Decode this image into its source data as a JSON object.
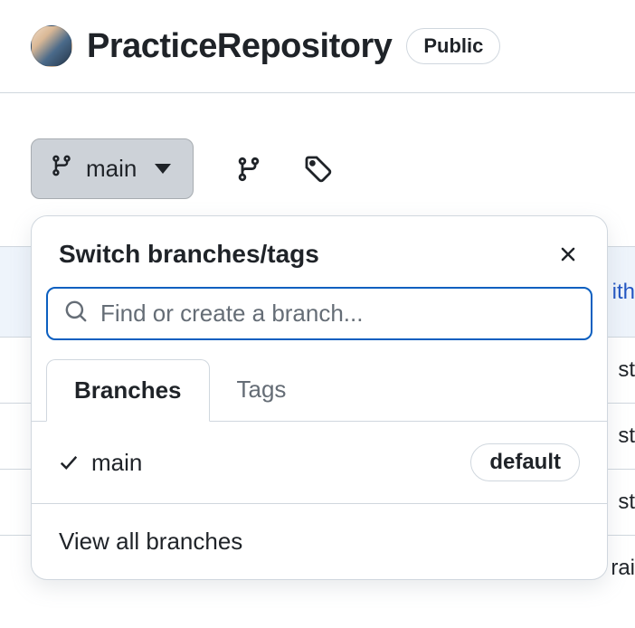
{
  "header": {
    "repo_name": "PracticeRepository",
    "visibility": "Public"
  },
  "toolbar": {
    "current_branch": "main"
  },
  "dropdown": {
    "title": "Switch branches/tags",
    "search_placeholder": "Find or create a branch...",
    "tabs": {
      "branches": "Branches",
      "tags": "Tags"
    },
    "branches": [
      {
        "name": "main",
        "default_label": "default",
        "selected": true
      }
    ],
    "view_all": "View all branches"
  },
  "bg_rows": [
    "ith",
    "st",
    "st",
    "st",
    "rai"
  ]
}
